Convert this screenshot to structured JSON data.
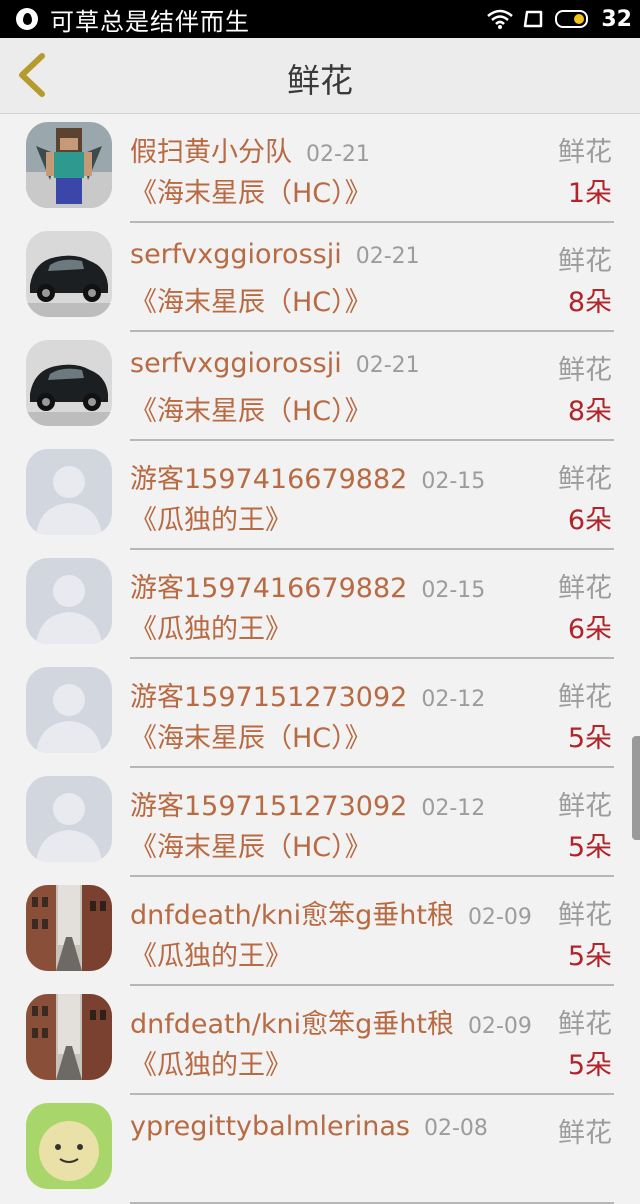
{
  "status_bar": {
    "title": "可草总是结伴而生",
    "time": "32"
  },
  "header": {
    "title": "鲜花"
  },
  "items": [
    {
      "name": "假扫黄小分队",
      "date": "02-21",
      "book": "《海末星辰（HC）》",
      "type": "鲜花",
      "count": "1朵",
      "avatar": "minecraft-avatar"
    },
    {
      "name": "serfvxggiorossji",
      "date": "02-21",
      "book": "《海末星辰（HC）》",
      "type": "鲜花",
      "count": "8朵",
      "avatar": "car-avatar"
    },
    {
      "name": "serfvxggiorossji",
      "date": "02-21",
      "book": "《海末星辰（HC）》",
      "type": "鲜花",
      "count": "8朵",
      "avatar": "car-avatar"
    },
    {
      "name": "游客1597416679882",
      "date": "02-15",
      "book": "《瓜独的王》",
      "type": "鲜花",
      "count": "6朵",
      "avatar": "default-avatar"
    },
    {
      "name": "游客1597416679882",
      "date": "02-15",
      "book": "《瓜独的王》",
      "type": "鲜花",
      "count": "6朵",
      "avatar": "default-avatar"
    },
    {
      "name": "游客1597151273092",
      "date": "02-12",
      "book": "《海末星辰（HC）》",
      "type": "鲜花",
      "count": "5朵",
      "avatar": "default-avatar"
    },
    {
      "name": "游客1597151273092",
      "date": "02-12",
      "book": "《海末星辰（HC）》",
      "type": "鲜花",
      "count": "5朵",
      "avatar": "default-avatar"
    },
    {
      "name": "dnfdeath/kni愈笨g垂ht稂",
      "date": "02-09",
      "book": "《瓜独的王》",
      "type": "鲜花",
      "count": "5朵",
      "avatar": "street-avatar"
    },
    {
      "name": "dnfdeath/kni愈笨g垂ht稂",
      "date": "02-09",
      "book": "《瓜独的王》",
      "type": "鲜花",
      "count": "5朵",
      "avatar": "street-avatar"
    },
    {
      "name": "ypregittybalmlerinas",
      "date": "02-08",
      "book": "",
      "type": "鲜花",
      "count": "",
      "avatar": "cartoon-avatar"
    }
  ],
  "colors": {
    "name": "#b86a42",
    "count": "#b0242a",
    "muted": "#9c9c9c",
    "back_arrow": "#b59a2c"
  }
}
